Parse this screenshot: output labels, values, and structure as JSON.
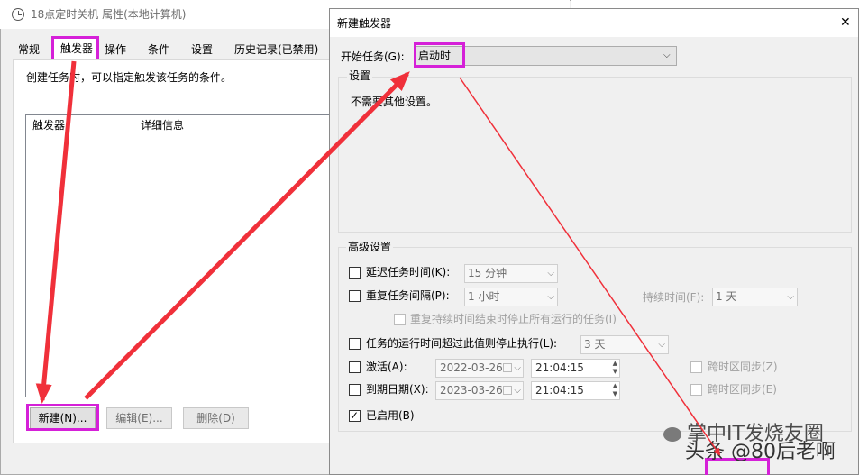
{
  "back_window": {
    "title": "18点定时关机 属性(本地计算机)",
    "tabs": [
      "常规",
      "触发器",
      "操作",
      "条件",
      "设置",
      "历史记录(已禁用)"
    ],
    "description": "创建任务时，可以指定触发该任务的条件。",
    "list_headers": [
      "触发器",
      "详细信息"
    ],
    "buttons": {
      "new": "新建(N)...",
      "edit": "编辑(E)...",
      "delete": "删除(D)"
    }
  },
  "dialog": {
    "title": "新建触发器",
    "close_glyph": "✕",
    "start_task_label": "开始任务(G):",
    "start_task_value": "启动时",
    "settings_group": "设置",
    "settings_text": "不需要其他设置。",
    "advanced_group": "高级设置",
    "delay_label": "延迟任务时间(K):",
    "delay_value": "15 分钟",
    "repeat_label": "重复任务间隔(P):",
    "repeat_value": "1 小时",
    "duration_label": "持续时间(F):",
    "duration_value": "1 天",
    "stop_repeat_label": "重复持续时间结束时停止所有运行的任务(I)",
    "stop_if_longer_label": "任务的运行时间超过此值则停止执行(L):",
    "stop_if_longer_value": "3 天",
    "activate_label": "激活(A):",
    "activate_date": "2022-03-26",
    "activate_time": "21:04:15",
    "expire_label": "到期日期(X):",
    "expire_date": "2023-03-26",
    "expire_time": "21:04:15",
    "sync_tz_1": "跨时区同步(Z)",
    "sync_tz_2": "跨时区同步(E)",
    "enabled_label": "已启用(B)",
    "enabled_check": "✓"
  },
  "watermark": {
    "line1": "掌中IT发烧友圈",
    "line2": "头条 @80后老啊"
  },
  "colors": {
    "highlight": "#d520d8",
    "arrow": "#f0303a"
  }
}
